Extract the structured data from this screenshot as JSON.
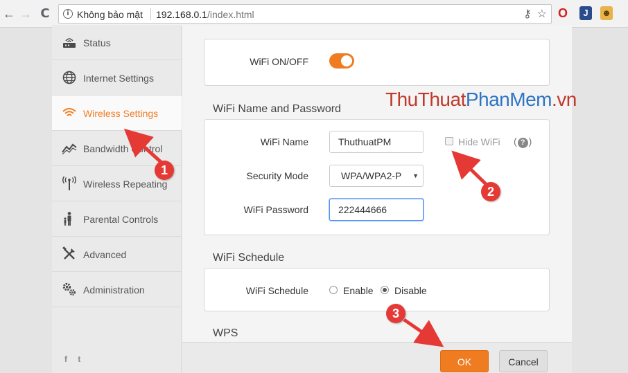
{
  "browser": {
    "back_icon": "←",
    "forward_icon": "→",
    "reload_icon": "C",
    "info_icon": "i",
    "security_label": "Không bảo mật",
    "url_host": "192.168.0.1",
    "url_path": "/index.html",
    "key_icon": "⚷",
    "star_icon": "☆",
    "ext_opera": "O",
    "ext_j": "J",
    "ext_face": "☻"
  },
  "sidebar": {
    "items": [
      {
        "label": "Status",
        "icon": "router-icon"
      },
      {
        "label": "Internet Settings",
        "icon": "globe-icon"
      },
      {
        "label": "Wireless Settings",
        "icon": "wifi-icon"
      },
      {
        "label": "Bandwidth Control",
        "icon": "chart-icon"
      },
      {
        "label": "Wireless Repeating",
        "icon": "antenna-icon"
      },
      {
        "label": "Parental Controls",
        "icon": "family-icon"
      },
      {
        "label": "Advanced",
        "icon": "tools-icon"
      },
      {
        "label": "Administration",
        "icon": "gears-icon"
      }
    ],
    "active_index": 2,
    "social": "f t"
  },
  "main": {
    "wifi_onoff_label": "WiFi ON/OFF",
    "wifi_on": true,
    "name_password_title": "WiFi Name and Password",
    "wifi_name_label": "WiFi Name",
    "wifi_name_value": "ThuthuatPM",
    "hide_wifi_label": "Hide WiFi",
    "hide_wifi_checked": false,
    "help_text_open": "(",
    "help_text_q": "?",
    "help_text_close": ")",
    "security_mode_label": "Security Mode",
    "security_mode_value": "WPA/WPA2-P",
    "wifi_password_label": "WiFi Password",
    "wifi_password_value": "222444666",
    "schedule_title": "WiFi Schedule",
    "schedule_label": "WiFi Schedule",
    "enable_label": "Enable",
    "disable_label": "Disable",
    "schedule_selected": "Disable",
    "wps_title": "WPS"
  },
  "footer": {
    "ok_label": "OK",
    "cancel_label": "Cancel"
  },
  "watermark": {
    "part1": "Thu",
    "part2": "Thuat",
    "part3": "PhanMem",
    "part4": ".vn"
  },
  "annotations": {
    "step1": "1",
    "step2": "2",
    "step3": "3",
    "color": "#e53935"
  },
  "colors": {
    "accent": "#f07c22",
    "annotation": "#e53935"
  }
}
